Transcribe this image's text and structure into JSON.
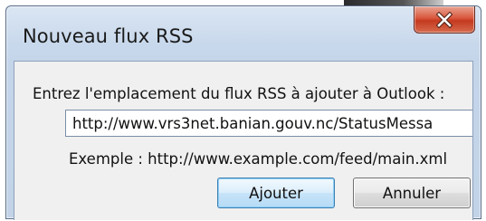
{
  "dialog": {
    "title": "Nouveau flux RSS",
    "prompt": "Entrez l'emplacement du flux RSS à ajouter à Outlook :",
    "url_value": "http://www.vrs3net.banian.gouv.nc/StatusMessa",
    "example": "Exemple : http://www.example.com/feed/main.xml",
    "ok_label": "Ajouter",
    "cancel_label": "Annuler",
    "close_icon": "close-icon"
  },
  "colors": {
    "close_button": "#d9573c",
    "default_button_border": "#3c7fb1",
    "frame": "#c4d5ea",
    "client_background": "#f0f0f0"
  }
}
